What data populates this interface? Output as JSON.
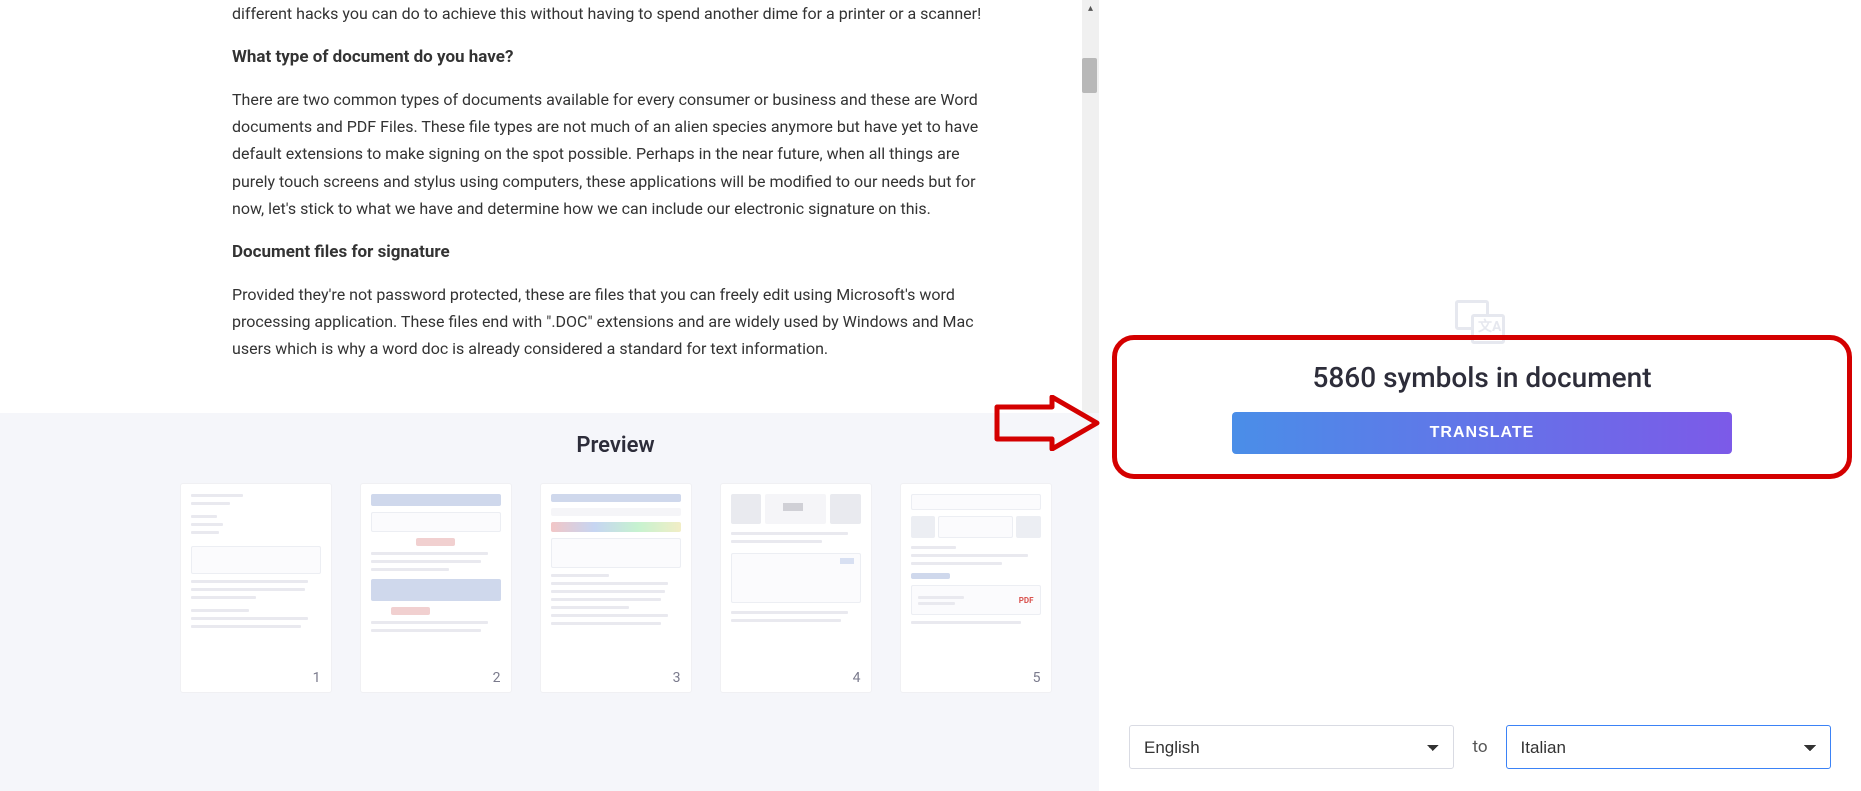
{
  "document": {
    "para_top": "different hacks you can do to achieve this without having to spend another dime for a printer or a scanner!",
    "heading1": "What type of document do you have?",
    "para1": "There are two common types of documents available for every consumer or business and these are Word documents and PDF Files. These file types are not much of an alien species anymore but have yet to have default extensions to make signing on the spot possible. Perhaps in the near future, when all things are purely touch screens and stylus using computers, these applications will be modified to our needs but for now, let's stick to what we have and determine how we can include our electronic signature on this.",
    "heading2": "Document files for signature",
    "para2": "Provided they're not password protected, these are files that you can freely edit using Microsoft's word processing application. These files end with \".DOC\" extensions and are widely used by Windows and Mac users which is why a word doc is already considered a standard for text information."
  },
  "preview": {
    "title": "Preview",
    "pages": [
      "1",
      "2",
      "3",
      "4",
      "5"
    ]
  },
  "translate": {
    "symbols_text": "5860 symbols in document",
    "button_label": "TRANSLATE",
    "to_label": "to",
    "source_lang": "English",
    "target_lang": "Italian"
  }
}
